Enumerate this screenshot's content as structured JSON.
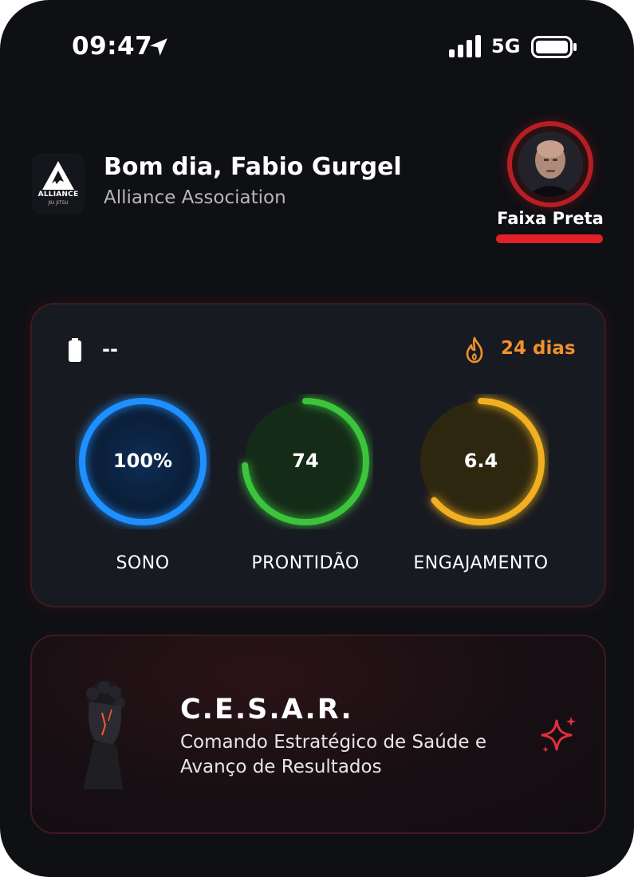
{
  "status_bar": {
    "time": "09:47",
    "network": "5G"
  },
  "header": {
    "logo_text": "ALLIANCE",
    "logo_subtext": "JIU JITSU",
    "greeting": "Bom dia, Fabio Gurgel",
    "organization": "Alliance Association",
    "belt_label": "Faixa Preta",
    "belt_color": "#e02128"
  },
  "metrics": {
    "battery_value": "--",
    "streak": "24 dias",
    "gauges": [
      {
        "label": "SONO",
        "value": "100%",
        "fill": 1.0,
        "color": "#1e90ff"
      },
      {
        "label": "PRONTIDÃO",
        "value": "74",
        "fill": 0.74,
        "color": "#3cc43c"
      },
      {
        "label": "ENGAJAMENTO",
        "value": "6.4",
        "fill": 0.64,
        "color": "#f0b020"
      }
    ]
  },
  "cesar": {
    "title": "C.E.S.A.R.",
    "description": "Comando Estratégico de Saúde e Avanço de Resultados",
    "accent_color": "#e0303a"
  },
  "icons": [
    "location-arrow-icon",
    "signal-icon",
    "battery-icon",
    "flame-icon",
    "sparkle-icon"
  ]
}
